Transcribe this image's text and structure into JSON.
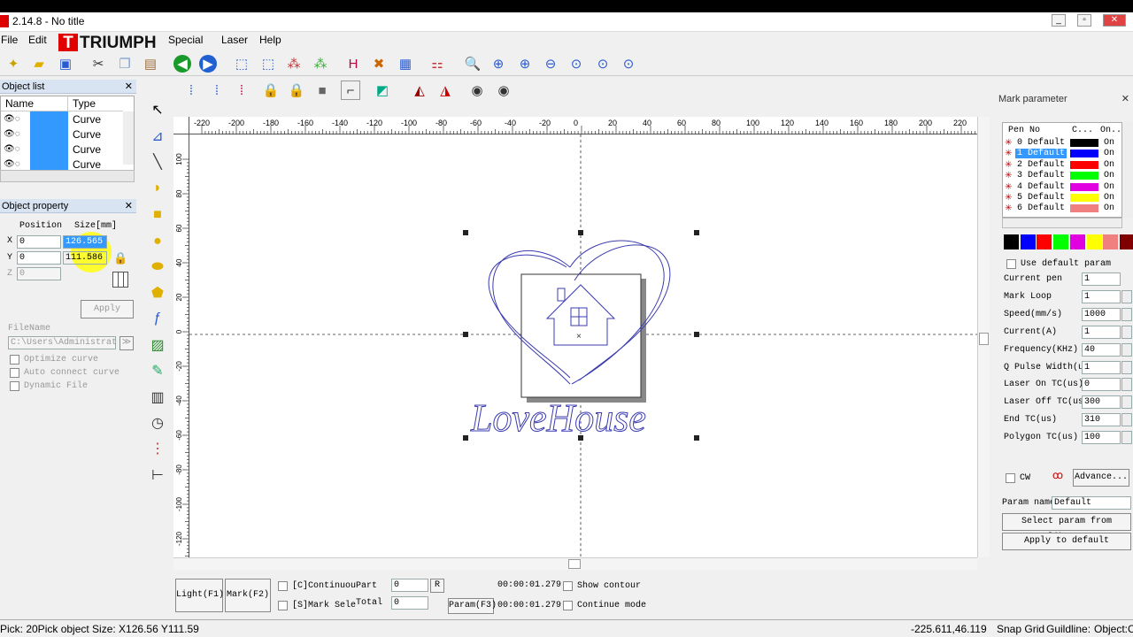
{
  "window": {
    "title": "2.14.8 - No title"
  },
  "menu": [
    "File",
    "Edit",
    "Special",
    "Laser",
    "Help"
  ],
  "logo": {
    "letter": "T",
    "text": "TRIUMPH"
  },
  "object_list": {
    "title": "Object list",
    "col_name": "Name",
    "col_type": "Type",
    "rows": [
      "Curve",
      "Curve",
      "Curve",
      "Curve"
    ]
  },
  "object_property": {
    "title": "Object property",
    "position_label": "Position",
    "size_label": "Size[mm]",
    "x_label": "X",
    "y_label": "Y",
    "z_label": "Z",
    "x_pos": "0",
    "y_pos": "0",
    "z_pos": "0",
    "x_size": "126.565",
    "y_size": "111.586",
    "apply": "Apply",
    "filename_label": "FileName",
    "filename_value": "C:\\Users\\Administrat",
    "optimize": "Optimize curve",
    "autoconnect": "Auto connect curve",
    "dynamic": "Dynamic File"
  },
  "ruler": {
    "h_ticks": [
      "-220",
      "-200",
      "-180",
      "-160",
      "-140",
      "-120",
      "-100",
      "-80",
      "-60",
      "-40",
      "-20",
      "0",
      "20",
      "40",
      "60",
      "80",
      "100",
      "120",
      "140",
      "160",
      "180",
      "200",
      "220"
    ],
    "v_ticks": [
      "100",
      "80",
      "60",
      "40",
      "20",
      "0",
      "-20",
      "-40",
      "-60",
      "-80",
      "-100",
      "-120"
    ]
  },
  "canvas": {
    "text": "LoveHouse"
  },
  "mark_parameter": {
    "title": "Mark parameter",
    "col_pen": "Pen No",
    "col_c": "C...",
    "col_on": "On...",
    "pens": [
      {
        "label": "0 Default",
        "color": "#000000",
        "on": "On"
      },
      {
        "label": "1 Default",
        "color": "#0000ff",
        "on": "On"
      },
      {
        "label": "2 Default",
        "color": "#ff0000",
        "on": "On"
      },
      {
        "label": "3 Default",
        "color": "#00ff00",
        "on": "On"
      },
      {
        "label": "4 Default",
        "color": "#e000e0",
        "on": "On"
      },
      {
        "label": "5 Default",
        "color": "#ffff00",
        "on": "On"
      },
      {
        "label": "6 Default",
        "color": "#f08080",
        "on": "On"
      }
    ],
    "palette": [
      "#000000",
      "#0000ff",
      "#ff0000",
      "#00ff00",
      "#e000e0",
      "#ffff00",
      "#f08080",
      "#800000"
    ],
    "use_default": "Use default param",
    "params": [
      {
        "label": "Current pen",
        "value": "1"
      },
      {
        "label": "Mark Loop",
        "value": "1"
      },
      {
        "label": "Speed(mm/s)",
        "value": "1000"
      },
      {
        "label": "Current(A)",
        "value": "1"
      },
      {
        "label": "Frequency(KHz)",
        "value": "40"
      },
      {
        "label": "Q Pulse Width(u",
        "value": "1"
      },
      {
        "label": "Laser On TC(us)",
        "value": "0"
      },
      {
        "label": "Laser Off TC(us",
        "value": "300"
      },
      {
        "label": "End TC(us)",
        "value": "310"
      },
      {
        "label": "Polygon TC(us)",
        "value": "100"
      }
    ],
    "cw": "CW",
    "advance": "Advance...",
    "param_name_label": "Param name",
    "param_name_value": "Default",
    "select_lib": "Select param from library",
    "apply_default": "Apply to default"
  },
  "bottom": {
    "light": "Light(F1)",
    "mark": "Mark(F2)",
    "continuous": "[C]Continuou",
    "mark_sel": "[S]Mark Sele",
    "part": "Part",
    "total": "Total",
    "part_val": "0",
    "total_val": "0",
    "r": "R",
    "param": "Param(F3)",
    "time1": "00:00:01.279",
    "time2": "00:00:01.279",
    "show_contour": "Show contour",
    "continue_mode": "Continue mode"
  },
  "status": {
    "left": "Pick: 20Pick object Size: X126.56 Y111.59",
    "coords": "-225.611,46.119",
    "snap": "Snap Grid",
    "guideline": "Guildline:",
    "object": "Object:C"
  }
}
